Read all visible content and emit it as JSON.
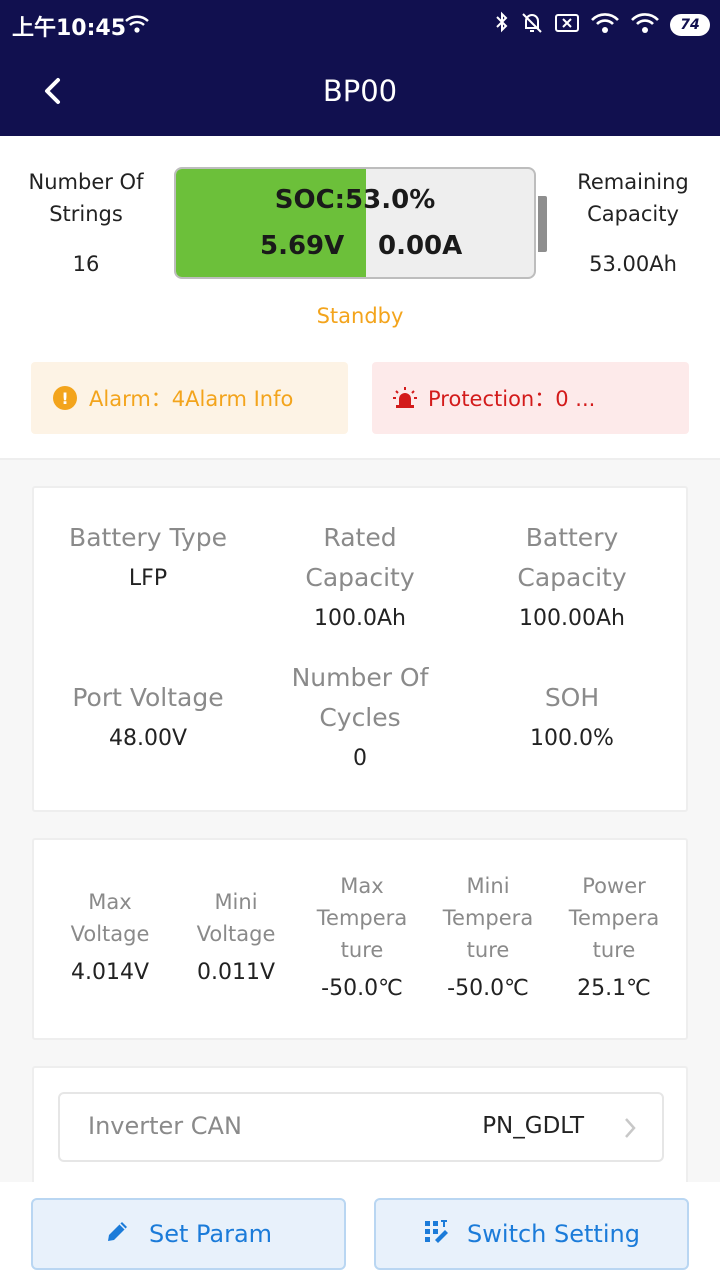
{
  "status_bar": {
    "time": "上午10:45",
    "battery_level": "74",
    "icons": [
      "wifi-icon",
      "bluetooth-icon",
      "mute-icon",
      "sim-off-icon",
      "wifi-icon",
      "wifi-icon",
      "battery-icon"
    ]
  },
  "header": {
    "title": "BP00",
    "back_icon": "chevron-left-icon"
  },
  "summary": {
    "strings_label_line1": "Number Of",
    "strings_label_line2": "Strings",
    "strings_value": "16",
    "remaining_label_line1": "Remaining",
    "remaining_label_line2": "Capacity",
    "remaining_value": "53.00Ah",
    "soc": "SOC:53.0%",
    "soc_fraction": 0.53,
    "voltage": "5.69V",
    "current": "0.00A",
    "state": "Standby"
  },
  "alerts": {
    "alarm": "Alarm：4Alarm Info",
    "protection": "Protection：0 ..."
  },
  "info_card": {
    "battery_type_label": "Battery Type",
    "battery_type_value": "LFP",
    "rated_capacity_line1": "Rated",
    "rated_capacity_line2": "Capacity",
    "rated_capacity_value": "100.0Ah",
    "battery_capacity_line1": "Battery",
    "battery_capacity_line2": "Capacity",
    "battery_capacity_value": "100.00Ah",
    "port_voltage_label": "Port Voltage",
    "port_voltage_value": "48.00V",
    "cycles_line1": "Number Of",
    "cycles_line2": "Cycles",
    "cycles_value": "0",
    "soh_label": "SOH",
    "soh_value": "100.0%"
  },
  "stats_card": {
    "max_voltage_line1": "Max",
    "max_voltage_line2": "Voltage",
    "max_voltage_value": "4.014V",
    "mini_voltage_line1": "Mini",
    "mini_voltage_line2": "Voltage",
    "mini_voltage_value": "0.011V",
    "max_temp_line1": "Max",
    "max_temp_line2": "Tempera",
    "max_temp_line3": "ture",
    "max_temp_value": "-50.0℃",
    "mini_temp_line1": "Mini",
    "mini_temp_line2": "Tempera",
    "mini_temp_line3": "ture",
    "mini_temp_value": "-50.0℃",
    "power_temp_line1": "Power",
    "power_temp_line2": "Tempera",
    "power_temp_line3": "ture",
    "power_temp_value": "25.1℃"
  },
  "inverter": {
    "label": "Inverter CAN",
    "value": "PN_GDLT"
  },
  "bottom_buttons": {
    "set_param": "Set Param",
    "switch_setting": "Switch Setting"
  },
  "colors": {
    "header_bg": "#11104f",
    "soc_green": "#6cc03a",
    "standby_orange": "#f3a41c",
    "protection_red": "#d31b1b",
    "button_blue": "#1b7bd9"
  }
}
